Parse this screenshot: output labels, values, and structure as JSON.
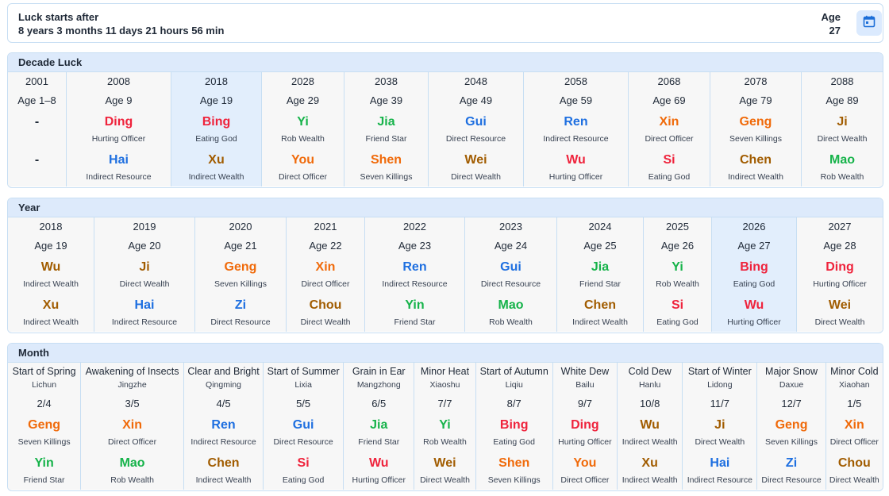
{
  "header": {
    "luck_label": "Luck starts after",
    "luck_value": "8 years 3 months 11 days 21 hours 56 min",
    "age_label": "Age",
    "age_value": "27",
    "calendar_icon": "calendar-icon"
  },
  "colors": {
    "fire": "#ef233c",
    "wood": "#16b34a",
    "water": "#1e6fe0",
    "metal": "#f06a0a",
    "earth": "#a15c00",
    "current_bg": "#e2eefc",
    "border": "#c7def3"
  },
  "decade": {
    "title": "Decade Luck",
    "cols": [
      {
        "year": "2001",
        "age": "Age 1–8",
        "stem": "-",
        "stem_el": "none",
        "stem_god": "",
        "branch": "-",
        "branch_el": "none",
        "branch_god": ""
      },
      {
        "year": "2008",
        "age": "Age 9",
        "stem": "Ding",
        "stem_el": "fire",
        "stem_god": "Hurting Officer",
        "branch": "Hai",
        "branch_el": "water",
        "branch_god": "Indirect Resource"
      },
      {
        "year": "2018",
        "age": "Age 19",
        "stem": "Bing",
        "stem_el": "fire",
        "stem_god": "Eating God",
        "branch": "Xu",
        "branch_el": "earth",
        "branch_god": "Indirect Wealth",
        "current": true
      },
      {
        "year": "2028",
        "age": "Age 29",
        "stem": "Yi",
        "stem_el": "wood",
        "stem_god": "Rob Wealth",
        "branch": "You",
        "branch_el": "metal",
        "branch_god": "Direct Officer"
      },
      {
        "year": "2038",
        "age": "Age 39",
        "stem": "Jia",
        "stem_el": "wood",
        "stem_god": "Friend Star",
        "branch": "Shen",
        "branch_el": "metal",
        "branch_god": "Seven Killings"
      },
      {
        "year": "2048",
        "age": "Age 49",
        "stem": "Gui",
        "stem_el": "water",
        "stem_god": "Direct Resource",
        "branch": "Wei",
        "branch_el": "earth",
        "branch_god": "Direct Wealth"
      },
      {
        "year": "2058",
        "age": "Age 59",
        "stem": "Ren",
        "stem_el": "water",
        "stem_god": "Indirect Resource",
        "branch": "Wu",
        "branch_el": "fire",
        "branch_god": "Hurting Officer"
      },
      {
        "year": "2068",
        "age": "Age 69",
        "stem": "Xin",
        "stem_el": "metal",
        "stem_god": "Direct Officer",
        "branch": "Si",
        "branch_el": "fire",
        "branch_god": "Eating God"
      },
      {
        "year": "2078",
        "age": "Age 79",
        "stem": "Geng",
        "stem_el": "metal",
        "stem_god": "Seven Killings",
        "branch": "Chen",
        "branch_el": "earth",
        "branch_god": "Indirect Wealth"
      },
      {
        "year": "2088",
        "age": "Age 89",
        "stem": "Ji",
        "stem_el": "earth",
        "stem_god": "Direct Wealth",
        "branch": "Mao",
        "branch_el": "wood",
        "branch_god": "Rob Wealth"
      }
    ]
  },
  "year": {
    "title": "Year",
    "cols": [
      {
        "year": "2018",
        "age": "Age 19",
        "stem": "Wu",
        "stem_el": "earth",
        "stem_god": "Indirect Wealth",
        "branch": "Xu",
        "branch_el": "earth",
        "branch_god": "Indirect Wealth"
      },
      {
        "year": "2019",
        "age": "Age 20",
        "stem": "Ji",
        "stem_el": "earth",
        "stem_god": "Direct Wealth",
        "branch": "Hai",
        "branch_el": "water",
        "branch_god": "Indirect Resource"
      },
      {
        "year": "2020",
        "age": "Age 21",
        "stem": "Geng",
        "stem_el": "metal",
        "stem_god": "Seven Killings",
        "branch": "Zi",
        "branch_el": "water",
        "branch_god": "Direct Resource"
      },
      {
        "year": "2021",
        "age": "Age 22",
        "stem": "Xin",
        "stem_el": "metal",
        "stem_god": "Direct Officer",
        "branch": "Chou",
        "branch_el": "earth",
        "branch_god": "Direct Wealth"
      },
      {
        "year": "2022",
        "age": "Age 23",
        "stem": "Ren",
        "stem_el": "water",
        "stem_god": "Indirect Resource",
        "branch": "Yin",
        "branch_el": "wood",
        "branch_god": "Friend Star"
      },
      {
        "year": "2023",
        "age": "Age 24",
        "stem": "Gui",
        "stem_el": "water",
        "stem_god": "Direct Resource",
        "branch": "Mao",
        "branch_el": "wood",
        "branch_god": "Rob Wealth"
      },
      {
        "year": "2024",
        "age": "Age 25",
        "stem": "Jia",
        "stem_el": "wood",
        "stem_god": "Friend Star",
        "branch": "Chen",
        "branch_el": "earth",
        "branch_god": "Indirect Wealth"
      },
      {
        "year": "2025",
        "age": "Age 26",
        "stem": "Yi",
        "stem_el": "wood",
        "stem_god": "Rob Wealth",
        "branch": "Si",
        "branch_el": "fire",
        "branch_god": "Eating God"
      },
      {
        "year": "2026",
        "age": "Age 27",
        "stem": "Bing",
        "stem_el": "fire",
        "stem_god": "Eating God",
        "branch": "Wu",
        "branch_el": "fire",
        "branch_god": "Hurting Officer",
        "current": true
      },
      {
        "year": "2027",
        "age": "Age 28",
        "stem": "Ding",
        "stem_el": "fire",
        "stem_god": "Hurting Officer",
        "branch": "Wei",
        "branch_el": "earth",
        "branch_god": "Direct Wealth"
      }
    ]
  },
  "month": {
    "title": "Month",
    "cols": [
      {
        "term": "Start of Spring",
        "pinyin": "Lichun",
        "date": "2/4",
        "stem": "Geng",
        "stem_el": "metal",
        "stem_god": "Seven Killings",
        "branch": "Yin",
        "branch_el": "wood",
        "branch_god": "Friend Star"
      },
      {
        "term": "Awakening of Insects",
        "pinyin": "Jingzhe",
        "date": "3/5",
        "stem": "Xin",
        "stem_el": "metal",
        "stem_god": "Direct Officer",
        "branch": "Mao",
        "branch_el": "wood",
        "branch_god": "Rob Wealth"
      },
      {
        "term": "Clear and Bright",
        "pinyin": "Qingming",
        "date": "4/5",
        "stem": "Ren",
        "stem_el": "water",
        "stem_god": "Indirect Resource",
        "branch": "Chen",
        "branch_el": "earth",
        "branch_god": "Indirect Wealth"
      },
      {
        "term": "Start of Summer",
        "pinyin": "Lixia",
        "date": "5/5",
        "stem": "Gui",
        "stem_el": "water",
        "stem_god": "Direct Resource",
        "branch": "Si",
        "branch_el": "fire",
        "branch_god": "Eating God"
      },
      {
        "term": "Grain in Ear",
        "pinyin": "Mangzhong",
        "date": "6/5",
        "stem": "Jia",
        "stem_el": "wood",
        "stem_god": "Friend Star",
        "branch": "Wu",
        "branch_el": "fire",
        "branch_god": "Hurting Officer"
      },
      {
        "term": "Minor Heat",
        "pinyin": "Xiaoshu",
        "date": "7/7",
        "stem": "Yi",
        "stem_el": "wood",
        "stem_god": "Rob Wealth",
        "branch": "Wei",
        "branch_el": "earth",
        "branch_god": "Direct Wealth"
      },
      {
        "term": "Start of Autumn",
        "pinyin": "Liqiu",
        "date": "8/7",
        "stem": "Bing",
        "stem_el": "fire",
        "stem_god": "Eating God",
        "branch": "Shen",
        "branch_el": "metal",
        "branch_god": "Seven Killings"
      },
      {
        "term": "White Dew",
        "pinyin": "Bailu",
        "date": "9/7",
        "stem": "Ding",
        "stem_el": "fire",
        "stem_god": "Hurting Officer",
        "branch": "You",
        "branch_el": "metal",
        "branch_god": "Direct Officer"
      },
      {
        "term": "Cold Dew",
        "pinyin": "Hanlu",
        "date": "10/8",
        "stem": "Wu",
        "stem_el": "earth",
        "stem_god": "Indirect Wealth",
        "branch": "Xu",
        "branch_el": "earth",
        "branch_god": "Indirect Wealth"
      },
      {
        "term": "Start of Winter",
        "pinyin": "Lidong",
        "date": "11/7",
        "stem": "Ji",
        "stem_el": "earth",
        "stem_god": "Direct Wealth",
        "branch": "Hai",
        "branch_el": "water",
        "branch_god": "Indirect Resource"
      },
      {
        "term": "Major Snow",
        "pinyin": "Daxue",
        "date": "12/7",
        "stem": "Geng",
        "stem_el": "metal",
        "stem_god": "Seven Killings",
        "branch": "Zi",
        "branch_el": "water",
        "branch_god": "Direct Resource"
      },
      {
        "term": "Minor Cold",
        "pinyin": "Xiaohan",
        "date": "1/5",
        "stem": "Xin",
        "stem_el": "metal",
        "stem_god": "Direct Officer",
        "branch": "Chou",
        "branch_el": "earth",
        "branch_god": "Direct Wealth"
      }
    ]
  }
}
